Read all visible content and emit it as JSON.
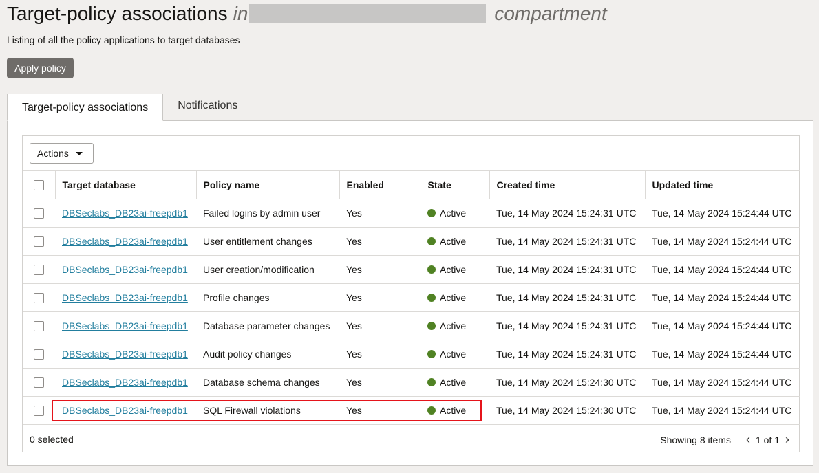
{
  "header": {
    "title": "Target-policy associations",
    "title_in": "in",
    "title_compartment": "compartment",
    "subtitle": "Listing of all the policy applications to target databases"
  },
  "apply_policy_label": "Apply policy",
  "tabs": [
    {
      "label": "Target-policy associations",
      "active": true
    },
    {
      "label": "Notifications",
      "active": false
    }
  ],
  "actions_label": "Actions",
  "columns": [
    "Target database",
    "Policy name",
    "Enabled",
    "State",
    "Created time",
    "Updated time"
  ],
  "rows": [
    {
      "target": "DBSeclabs_DB23ai-freepdb1",
      "policy": "Failed logins by admin user",
      "enabled": "Yes",
      "state": "Active",
      "created": "Tue, 14 May 2024 15:24:31 UTC",
      "updated": "Tue, 14 May 2024 15:24:44 UTC"
    },
    {
      "target": "DBSeclabs_DB23ai-freepdb1",
      "policy": "User entitlement changes",
      "enabled": "Yes",
      "state": "Active",
      "created": "Tue, 14 May 2024 15:24:31 UTC",
      "updated": "Tue, 14 May 2024 15:24:44 UTC"
    },
    {
      "target": "DBSeclabs_DB23ai-freepdb1",
      "policy": "User creation/modification",
      "enabled": "Yes",
      "state": "Active",
      "created": "Tue, 14 May 2024 15:24:31 UTC",
      "updated": "Tue, 14 May 2024 15:24:44 UTC"
    },
    {
      "target": "DBSeclabs_DB23ai-freepdb1",
      "policy": "Profile changes",
      "enabled": "Yes",
      "state": "Active",
      "created": "Tue, 14 May 2024 15:24:31 UTC",
      "updated": "Tue, 14 May 2024 15:24:44 UTC"
    },
    {
      "target": "DBSeclabs_DB23ai-freepdb1",
      "policy": "Database parameter changes",
      "enabled": "Yes",
      "state": "Active",
      "created": "Tue, 14 May 2024 15:24:31 UTC",
      "updated": "Tue, 14 May 2024 15:24:44 UTC"
    },
    {
      "target": "DBSeclabs_DB23ai-freepdb1",
      "policy": "Audit policy changes",
      "enabled": "Yes",
      "state": "Active",
      "created": "Tue, 14 May 2024 15:24:31 UTC",
      "updated": "Tue, 14 May 2024 15:24:44 UTC"
    },
    {
      "target": "DBSeclabs_DB23ai-freepdb1",
      "policy": "Database schema changes",
      "enabled": "Yes",
      "state": "Active",
      "created": "Tue, 14 May 2024 15:24:30 UTC",
      "updated": "Tue, 14 May 2024 15:24:44 UTC"
    },
    {
      "target": "DBSeclabs_DB23ai-freepdb1",
      "policy": "SQL Firewall violations",
      "enabled": "Yes",
      "state": "Active",
      "created": "Tue, 14 May 2024 15:24:30 UTC",
      "updated": "Tue, 14 May 2024 15:24:44 UTC"
    }
  ],
  "footer": {
    "selected": "0 selected",
    "showing": "Showing 8 items",
    "page": "1 of 1"
  },
  "colors": {
    "active_state": "#508223",
    "link": "#227e9e",
    "highlight": "#e5141b",
    "apply_button": "#6f6c69"
  },
  "icons": {
    "actions_caret": "caret-down-icon",
    "prev_page": "chevron-left-icon",
    "next_page": "chevron-right-icon"
  }
}
